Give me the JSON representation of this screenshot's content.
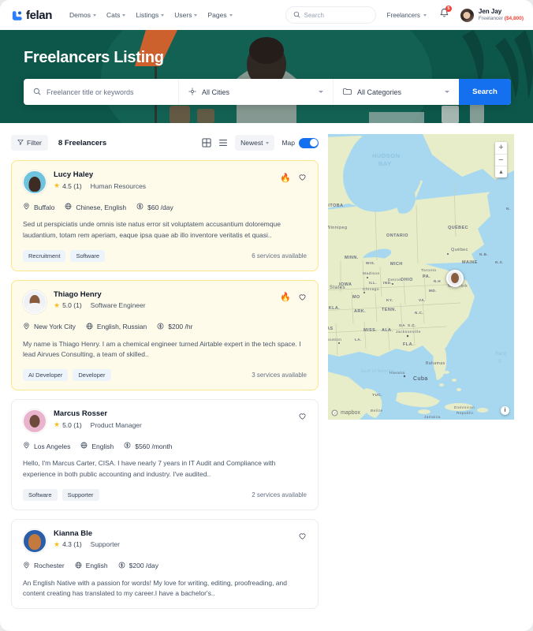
{
  "header": {
    "logo_text": "felan",
    "nav": [
      {
        "label": "Demos"
      },
      {
        "label": "Cats"
      },
      {
        "label": "Listings"
      },
      {
        "label": "Users"
      },
      {
        "label": "Pages"
      }
    ],
    "search_placeholder": "Search",
    "role_selector": "Freelancers",
    "notification_count": "5",
    "user_name": "Jen Jay",
    "user_role": "Freelancer",
    "user_balance": "($4,800)"
  },
  "hero": {
    "title": "Freelancers Listing",
    "keyword_placeholder": "Freelancer title or keywords",
    "city_value": "All Cities",
    "category_value": "All Categories",
    "search_button": "Search"
  },
  "toolbar": {
    "filter_label": "Filter",
    "results_count": "8 Freelancers",
    "sort_value": "Newest",
    "map_label": "Map"
  },
  "cards": [
    {
      "name": "Lucy Haley",
      "rating": "4.5 (1)",
      "role": "Human Resources",
      "location": "Buffalo",
      "languages": "Chinese, English",
      "price": "$60 /day",
      "description": "Sed ut perspiciatis unde omnis iste natus error sit voluptatem accusantium doloremque laudantium, totam rem aperiam, eaque ipsa quae ab illo inventore veritatis et quasi..",
      "tags": [
        "Recruitment",
        "Software"
      ],
      "services": "6 services available",
      "featured": true
    },
    {
      "name": "Thiago Henry",
      "rating": "5.0 (1)",
      "role": "Software Engineer",
      "location": "New York City",
      "languages": "English, Russian",
      "price": "$200 /hr",
      "description": "My name is Thiago Henry. I am a chemical engineer turned Airtable expert in the tech space. I lead Airvues Consulting, a team of skilled..",
      "tags": [
        "AI Developer",
        "Developer"
      ],
      "services": "3 services available",
      "featured": true
    },
    {
      "name": "Marcus Rosser",
      "rating": "5.0 (1)",
      "role": "Product Manager",
      "location": "Los Angeles",
      "languages": "English",
      "price": "$560 /month",
      "description": "Hello, I'm Marcus Carter, CISA. I have nearly 7  years in IT Audit and Compliance with experience in both public accounting and industry. I've audited..",
      "tags": [
        "Software",
        "Supporter"
      ],
      "services": "2 services available",
      "featured": false
    },
    {
      "name": "Kianna Ble",
      "rating": "4.3 (1)",
      "role": "Supporter",
      "location": "Rochester",
      "languages": "English",
      "price": "$200 /day",
      "description": "An English Native with a passion for words! My love for writing, editing, proofreading, and content creating has translated to my career.I have a bachelor's..",
      "tags": [],
      "services": "",
      "featured": false
    }
  ],
  "map": {
    "zoom_in": "+",
    "zoom_out": "−",
    "compass": "▲",
    "attribution": "mapbox",
    "info": "i",
    "labels": [
      "Hudson Bay",
      "MANITOBA",
      "ONTARIO",
      "QUÉBEC",
      "Winnipeg",
      "Québec",
      "MINN.",
      "WIS.",
      "MICH.",
      "Madison",
      "Detroit",
      "Toronto",
      "N.B.",
      "MAINE",
      "N.S.",
      "IOWA",
      "Chicago",
      "ILL.",
      "IND.",
      "OHIO",
      "PA.",
      "New York",
      "VT",
      "N.H.",
      "MD.",
      "MO.",
      "KY.",
      "VA.",
      "OKLA.",
      "ARK.",
      "TENN.",
      "N.C.",
      "S.C.",
      "MISS.",
      "ALA.",
      "GA.",
      "TEXAS",
      "LA.",
      "Houston",
      "Jacksonville",
      "FLA.",
      "Gulf of Mexico",
      "United States",
      "Bahamas",
      "Havana",
      "Cuba",
      "Jamaica",
      "Dominican Republic",
      "YUC.",
      "Belize",
      "Sargasso Sea"
    ]
  },
  "colors": {
    "accent": "#1570ef",
    "hero": "#0c5448",
    "highlight_bg": "#fffbeb",
    "star": "#f5bf23"
  }
}
